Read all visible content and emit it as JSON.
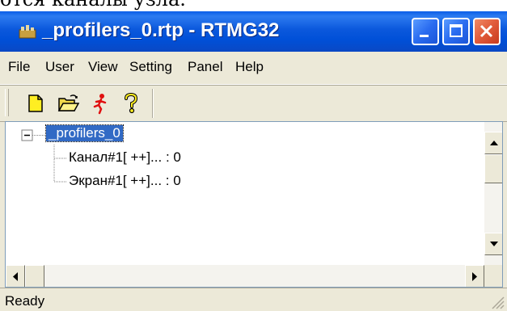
{
  "page_caption": "отся каналы узла.",
  "window": {
    "title": "_profilers_0.rtp - RTMG32",
    "controls": [
      "minimize",
      "maximize",
      "close"
    ]
  },
  "menu": {
    "items": [
      {
        "label": "File"
      },
      {
        "label": "User"
      },
      {
        "label": "View"
      },
      {
        "label": "Setting"
      },
      {
        "label": "Panel"
      },
      {
        "label": "Help"
      }
    ]
  },
  "toolbar": {
    "icons": [
      "new-document-icon",
      "open-folder-icon",
      "running-man-icon",
      "help-icon"
    ]
  },
  "tree": {
    "root": {
      "label": "_profilers_0",
      "expanded": true,
      "selected": true
    },
    "children": [
      {
        "label": "Канал#1[ ++]... : 0"
      },
      {
        "label": "Экран#1[ ++]... : 0"
      }
    ]
  },
  "status": {
    "text": "Ready"
  },
  "colors": {
    "titlebar": "#0054e3",
    "window_face": "#ece9d8",
    "selection": "#316ac5",
    "close_button": "#e05a3a"
  }
}
